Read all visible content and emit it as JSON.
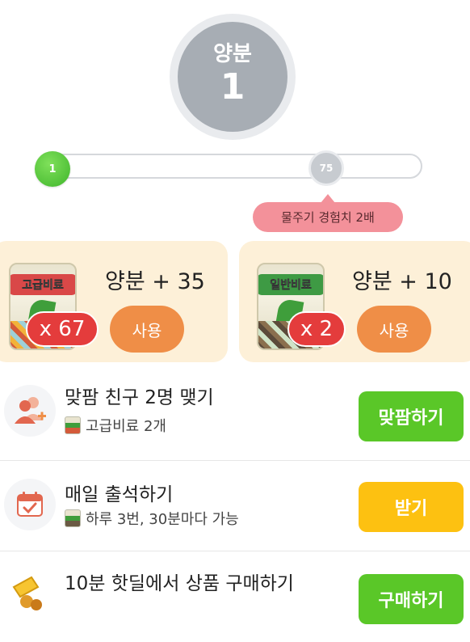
{
  "level": {
    "label": "양분",
    "value": "1"
  },
  "progress": {
    "start_marker": "1",
    "milestone_marker": "75",
    "milestone_tooltip": "물주기 경험치 2배"
  },
  "fertilizers": [
    {
      "bag_label": "고급비료",
      "count": "x 67",
      "title": "양분 + 35",
      "use_label": "사용",
      "label_color": "#d94848"
    },
    {
      "bag_label": "일반비료",
      "count": "x 2",
      "title": "양분 + 10",
      "use_label": "사용",
      "label_color": "#3e9a44"
    }
  ],
  "missions": [
    {
      "title": "맞팜 친구 2명 맺기",
      "reward": "고급비료 2개",
      "button": "맞팜하기",
      "icon": "add-friend-icon",
      "button_color": "#5ac728"
    },
    {
      "title": "매일 출석하기",
      "reward": "하루 3번, 30분마다 가능",
      "button": "받기",
      "icon": "calendar-check-icon",
      "button_color": "#fdc111"
    },
    {
      "title": "10분 핫딜에서 상품 구매하기",
      "reward": "",
      "button": "구매하기",
      "icon": "hot-deal-icon",
      "button_color": "#5ac728"
    }
  ],
  "colors": {
    "accent_green": "#5ac728",
    "accent_orange": "#ef8e47",
    "badge_red": "#e43c3c",
    "card_bg": "#fdf0d8",
    "tooltip_pink": "#f3919a"
  }
}
